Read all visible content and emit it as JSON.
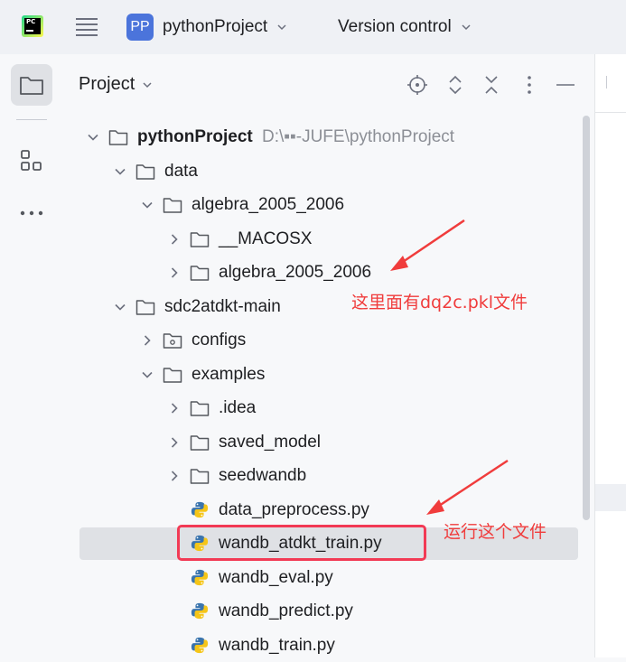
{
  "topbar": {
    "project_badge": "PP",
    "project_name": "pythonProject",
    "vcs_label": "Version control"
  },
  "panel": {
    "title": "Project"
  },
  "tree": [
    {
      "label": "pythonProject",
      "hint": "D:\\▪▪-JUFE\\pythonProject",
      "kind": "folder",
      "expanded": true,
      "depth": 0
    },
    {
      "label": "data",
      "kind": "folder",
      "expanded": true,
      "depth": 1
    },
    {
      "label": "algebra_2005_2006",
      "kind": "folder",
      "expanded": true,
      "depth": 2
    },
    {
      "label": "__MACOSX",
      "kind": "folder",
      "expanded": false,
      "depth": 3
    },
    {
      "label": "algebra_2005_2006",
      "kind": "folder",
      "expanded": false,
      "depth": 3
    },
    {
      "label": "sdc2atdkt-main",
      "kind": "folder",
      "expanded": true,
      "depth": 1
    },
    {
      "label": "configs",
      "kind": "package",
      "expanded": false,
      "depth": 2
    },
    {
      "label": "examples",
      "kind": "folder",
      "expanded": true,
      "depth": 2
    },
    {
      "label": ".idea",
      "kind": "folder",
      "expanded": false,
      "depth": 3
    },
    {
      "label": "saved_model",
      "kind": "folder",
      "expanded": false,
      "depth": 3
    },
    {
      "label": "seedwandb",
      "kind": "folder",
      "expanded": false,
      "depth": 3
    },
    {
      "label": "data_preprocess.py",
      "kind": "python",
      "depth": 3
    },
    {
      "label": "wandb_atdkt_train.py",
      "kind": "python",
      "depth": 3,
      "selected": true
    },
    {
      "label": "wandb_eval.py",
      "kind": "python",
      "depth": 3
    },
    {
      "label": "wandb_predict.py",
      "kind": "python",
      "depth": 3
    },
    {
      "label": "wandb_train.py",
      "kind": "python",
      "depth": 3
    }
  ],
  "annotations": {
    "note1": "这里面有dq2c.pkl文件",
    "note2": "运行这个文件"
  },
  "colors": {
    "accent": "#4b74db",
    "annotation": "#f03c3c",
    "selection": "#dfe1e5"
  }
}
